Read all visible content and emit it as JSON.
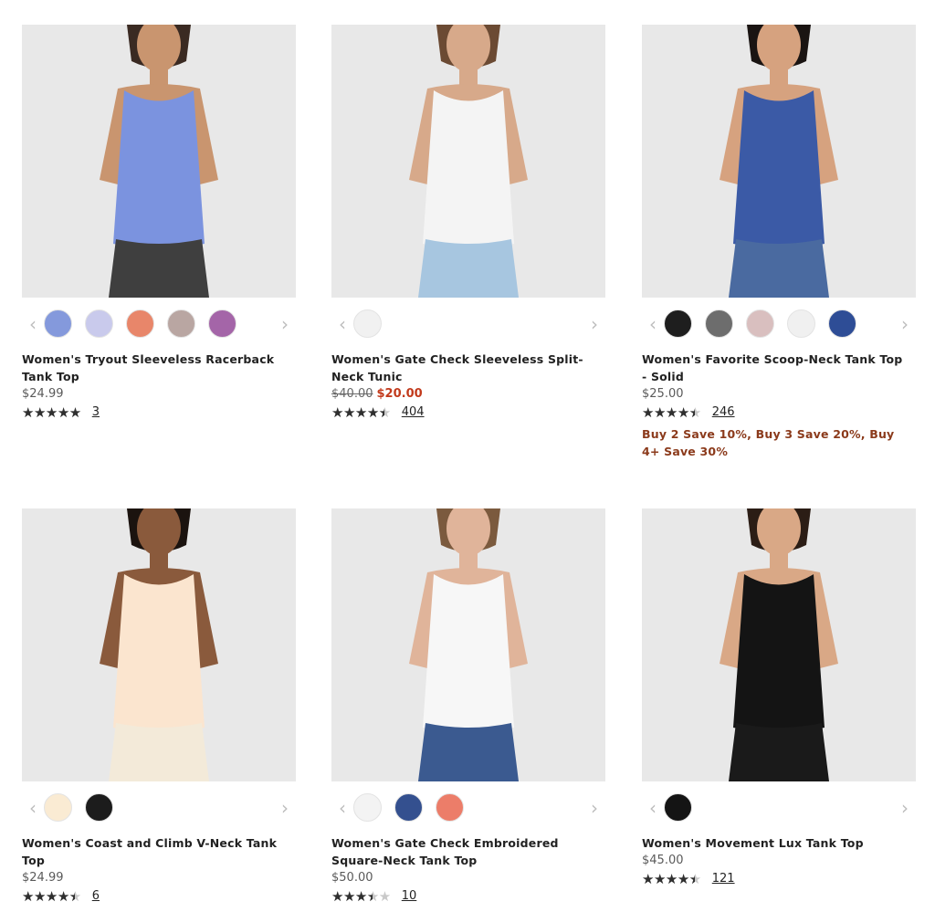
{
  "products": [
    {
      "name": "Women's Tryout Sleeveless Racerback Tank Top",
      "price": "$24.99",
      "rating": 5,
      "review_count": "3",
      "swatches": [
        "#8499dc",
        "#c9caec",
        "#e8866a",
        "#b9a6a2",
        "#a465a8"
      ],
      "image": {
        "bg": "#e8e8e8",
        "skin": "#c9956f",
        "top": "#7b93df",
        "bottom": "#3f3f3f",
        "hair": "#3a2a22"
      }
    },
    {
      "name": "Women's Gate Check Sleeveless Split-Neck Tunic",
      "price_was": "$40.00",
      "price_now": "$20.00",
      "rating": 4.5,
      "review_count": "404",
      "swatches": [
        "#f1f1f1"
      ],
      "image": {
        "bg": "#e8e8e8",
        "skin": "#d7a98a",
        "top": "#f4f4f4",
        "bottom": "#a7c6e0",
        "hair": "#6b4a33"
      }
    },
    {
      "name": "Women's Favorite Scoop-Neck Tank Top - Solid",
      "price": "$25.00",
      "rating": 4.5,
      "review_count": "246",
      "promo": "Buy 2 Save 10%, Buy 3 Save 20%, Buy 4+ Save 30%",
      "swatches": [
        "#1e1e1e",
        "#6d6d6d",
        "#d9bfbf",
        "#f0f0f0",
        "#2e4d96"
      ],
      "image": {
        "bg": "#e8e8e8",
        "skin": "#d6a27f",
        "top": "#3b5aa6",
        "bottom": "#4a6aa0",
        "hair": "#1a1412"
      }
    },
    {
      "name": "Women's Coast and Climb V-Neck Tank Top",
      "price": "$24.99",
      "rating": 4.5,
      "review_count": "6",
      "swatches": [
        "#faebd3",
        "#1c1c1c"
      ],
      "image": {
        "bg": "#e8e8e8",
        "skin": "#8a5a3c",
        "top": "#fbe5cf",
        "bottom": "#f3ead9",
        "hair": "#1b130f"
      }
    },
    {
      "name": "Women's Gate Check Embroidered Square-Neck Tank Top",
      "price": "$50.00",
      "rating": 3.5,
      "review_count": "10",
      "swatches": [
        "#f3f3f3",
        "#34508f",
        "#ec7d69"
      ],
      "image": {
        "bg": "#e8e8e8",
        "skin": "#e0b49a",
        "top": "#f7f7f7",
        "bottom": "#3b5a90",
        "hair": "#7b5a3e"
      }
    },
    {
      "name": "Women's Movement Lux Tank Top",
      "price": "$45.00",
      "rating": 4.5,
      "review_count": "121",
      "swatches": [
        "#141414"
      ],
      "image": {
        "bg": "#e8e8e8",
        "skin": "#d9a886",
        "top": "#141414",
        "bottom": "#1a1a1a",
        "hair": "#2b1d15"
      }
    }
  ],
  "ui": {
    "arrow_left": "‹",
    "arrow_right": "›",
    "star_glyphs": "★★★★★"
  }
}
